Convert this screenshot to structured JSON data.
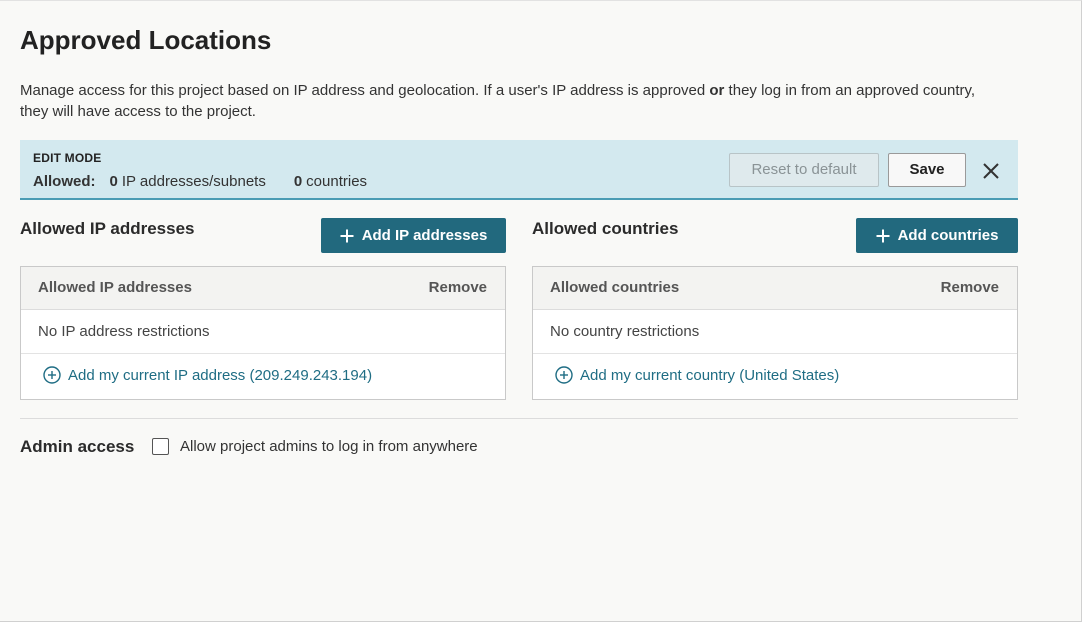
{
  "page": {
    "title": "Approved Locations",
    "description_pre": "Manage access for this project based on IP address and geolocation. If a user's IP address is approved ",
    "description_bold": "or",
    "description_post": " they log in from an approved country, they will have access to the project."
  },
  "edit_banner": {
    "mode_label": "EDIT MODE",
    "allowed_label": "Allowed:",
    "ip_count": "0",
    "ip_unit": "IP addresses/subnets",
    "country_count": "0",
    "country_unit": "countries",
    "reset_label": "Reset to default",
    "save_label": "Save",
    "close_icon": "close-icon"
  },
  "ip_section": {
    "heading": "Allowed IP addresses",
    "add_button": "Add IP addresses",
    "table": {
      "column_title": "Allowed IP addresses",
      "column_remove": "Remove",
      "empty_text": "No IP address restrictions",
      "add_current_link": "Add my current IP address (209.249.243.194)"
    }
  },
  "country_section": {
    "heading": "Allowed countries",
    "add_button": "Add countries",
    "table": {
      "column_title": "Allowed countries",
      "column_remove": "Remove",
      "empty_text": "No country restrictions",
      "add_current_link": "Add my current country (United States)"
    }
  },
  "admin": {
    "label": "Admin access",
    "checkbox_label": "Allow project admins to log in from anywhere",
    "checked": false
  },
  "colors": {
    "primary_button": "#22697e",
    "link": "#1f6d84",
    "banner_bg": "#d3e9ef",
    "banner_border": "#4a9cb4"
  }
}
